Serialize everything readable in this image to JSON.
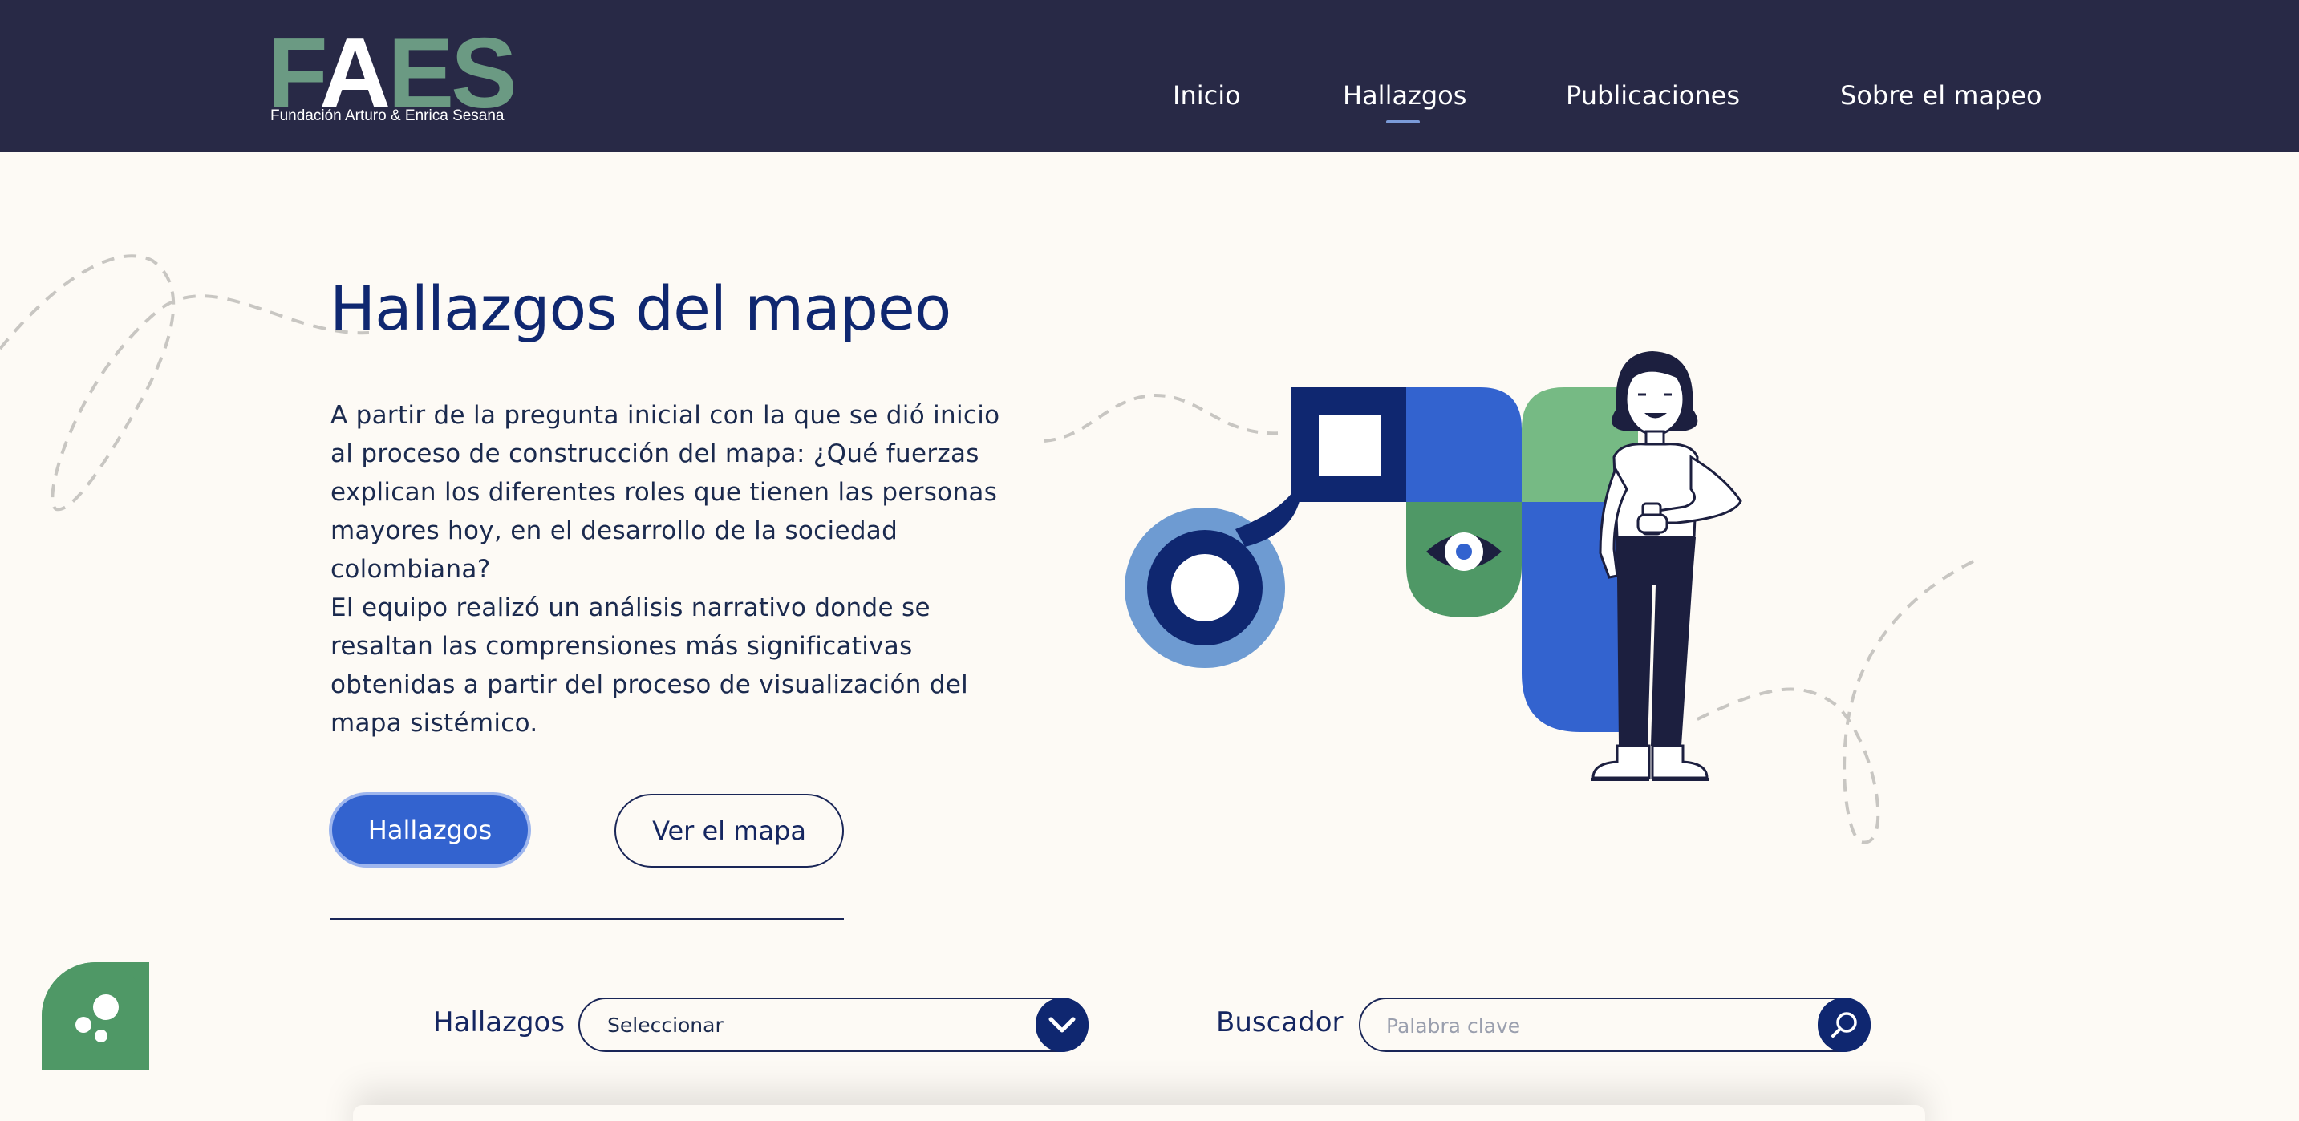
{
  "header": {
    "logo": {
      "word_part1": "F",
      "word_part2": "A",
      "word_part3": "ES",
      "subtitle": "Fundación Arturo & Enrica Sesana"
    },
    "nav": [
      {
        "label": "Inicio"
      },
      {
        "label": "Hallazgos",
        "active": true
      },
      {
        "label": "Publicaciones"
      },
      {
        "label": "Sobre el mapeo"
      }
    ]
  },
  "hero": {
    "title": "Hallazgos del mapeo",
    "paragraph1": "A partir de la pregunta inicial con la que se dió inicio al proceso de construcción del mapa: ¿Qué fuerzas explican los diferentes roles que tienen las personas mayores hoy, en el desarrollo de la sociedad colombiana?",
    "paragraph2": "El equipo realizó un análisis narrativo donde se resaltan las comprensiones más significativas obtenidas a partir del proceso de visualización del mapa sistémico.",
    "primary_button": "Hallazgos",
    "secondary_button": "Ver el mapa"
  },
  "filters": {
    "hallazgos_label": "Hallazgos",
    "select_value": "Seleccionar",
    "search_label": "Buscador",
    "search_placeholder": "Palabra clave"
  },
  "colors": {
    "header_bg": "#282946",
    "page_bg": "#fdfaf5",
    "primary_blue": "#3363cf",
    "navy": "#0f2770",
    "green": "#4f9866",
    "light_green": "#76ba84",
    "light_blue": "#6e9bd2"
  },
  "icons": {
    "select_toggle": "chevron-down-icon",
    "search": "search-icon",
    "chat": "chat-bubble-icon"
  }
}
